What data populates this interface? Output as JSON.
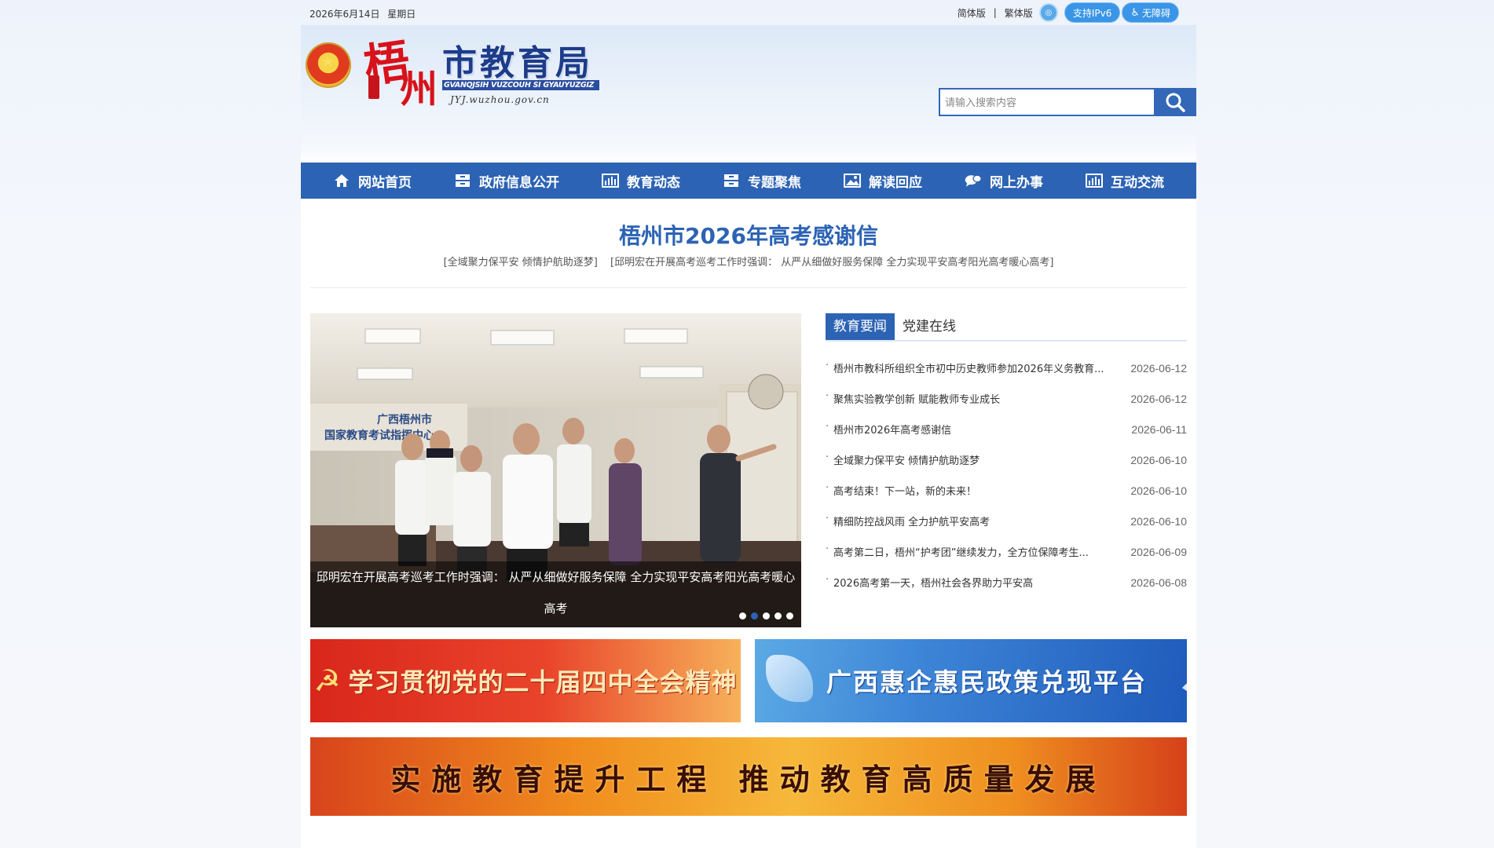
{
  "topbar": {
    "date": "2026年6月14日",
    "weekday": "星期日",
    "lang_simplified": "简体版",
    "lang_separator": "|",
    "lang_traditional": "繁体版",
    "ipv6_label": "支持IPv6",
    "accessibility_label": "无障碍"
  },
  "header": {
    "logo_city_char1": "梧",
    "logo_city_char2": "州",
    "logo_title": "市教育局",
    "logo_pinyin": "GVANQJSIH VUZCOUH SI GYAUYUZGIZ",
    "logo_url": "JYJ.wuzhou.gov.cn",
    "search_placeholder": "请输入搜索内容"
  },
  "nav": {
    "items": [
      {
        "label": "网站首页",
        "icon": "home-icon"
      },
      {
        "label": "政府信息公开",
        "icon": "drawer-icon"
      },
      {
        "label": "教育动态",
        "icon": "bar-chart-icon"
      },
      {
        "label": "专题聚焦",
        "icon": "drawer-icon"
      },
      {
        "label": "解读回应",
        "icon": "image-icon"
      },
      {
        "label": "网上办事",
        "icon": "chat-icon"
      },
      {
        "label": "互动交流",
        "icon": "bar-chart-icon"
      }
    ]
  },
  "headline": {
    "title": "梧州市2026年高考感谢信",
    "sub1": "[全域聚力保平安 倾情护航助逐梦]",
    "sub2": "[邱明宏在开展高考巡考工作时强调： 从严从细做好服务保障 全力实现平安高考阳光高考暖心高考]"
  },
  "slider": {
    "caption": "邱明宏在开展高考巡考工作时强调： 从严从细做好服务保障 全力实现平安高考阳光高考暖心高考",
    "photo_sign_line1": "广西梧州市",
    "photo_sign_line2": "国家教育考试指挥中心",
    "dots": 5,
    "active_dot": 2
  },
  "news": {
    "tabs": [
      "教育要闻",
      "党建在线"
    ],
    "active_tab": 0,
    "items": [
      {
        "title": "梧州市教科所组织全市初中历史教师参加2026年义务教育...",
        "date": "2026-06-12"
      },
      {
        "title": "聚焦实验教学创新 赋能教师专业成长",
        "date": "2026-06-12"
      },
      {
        "title": "梧州市2026年高考感谢信",
        "date": "2026-06-11"
      },
      {
        "title": "全域聚力保平安 倾情护航助逐梦",
        "date": "2026-06-10"
      },
      {
        "title": "高考结束！下一站，新的未来！",
        "date": "2026-06-10"
      },
      {
        "title": "精细防控战风雨 全力护航平安高考",
        "date": "2026-06-10"
      },
      {
        "title": "高考第二日，梧州“护考团”继续发力，全方位保障考生...",
        "date": "2026-06-09"
      },
      {
        "title": "2026高考第一天，梧州社会各界助力平安高",
        "date": "2026-06-08"
      }
    ]
  },
  "banners": {
    "party": "学习贯彻党的二十届四中全会精神",
    "policy": "广西惠企惠民政策兑现平台",
    "education": "实施教育提升工程 推动教育高质量发展"
  },
  "colors": {
    "primary": "#2c63b4",
    "party_red": "#d9261c",
    "banner_orange": "#f08b1d"
  }
}
